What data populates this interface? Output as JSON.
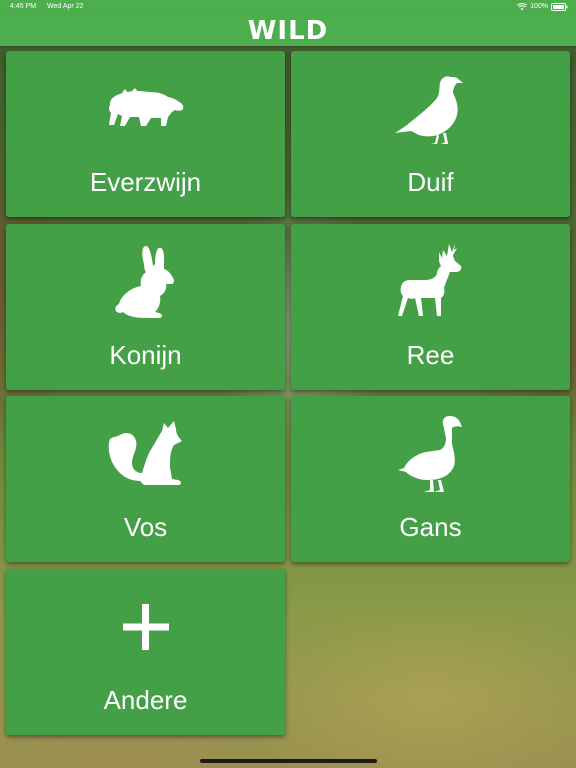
{
  "status_bar": {
    "time": "4:45 PM",
    "date": "Wed Apr 22",
    "battery": "100%",
    "wifi_icon": "wifi-icon",
    "battery_icon": "battery-icon"
  },
  "nav": {
    "title": "WILD",
    "bar_color": "#4cae4c"
  },
  "tiles": [
    {
      "label": "Everzwijn",
      "icon": "boar-icon"
    },
    {
      "label": "Duif",
      "icon": "pigeon-icon"
    },
    {
      "label": "Konijn",
      "icon": "rabbit-icon"
    },
    {
      "label": "Ree",
      "icon": "deer-icon"
    },
    {
      "label": "Vos",
      "icon": "fox-icon"
    },
    {
      "label": "Gans",
      "icon": "goose-icon"
    },
    {
      "label": "Andere",
      "icon": "plus-icon"
    }
  ],
  "colors": {
    "tile": "#43a047",
    "accent": "#4cae4c",
    "text": "#ffffff"
  }
}
